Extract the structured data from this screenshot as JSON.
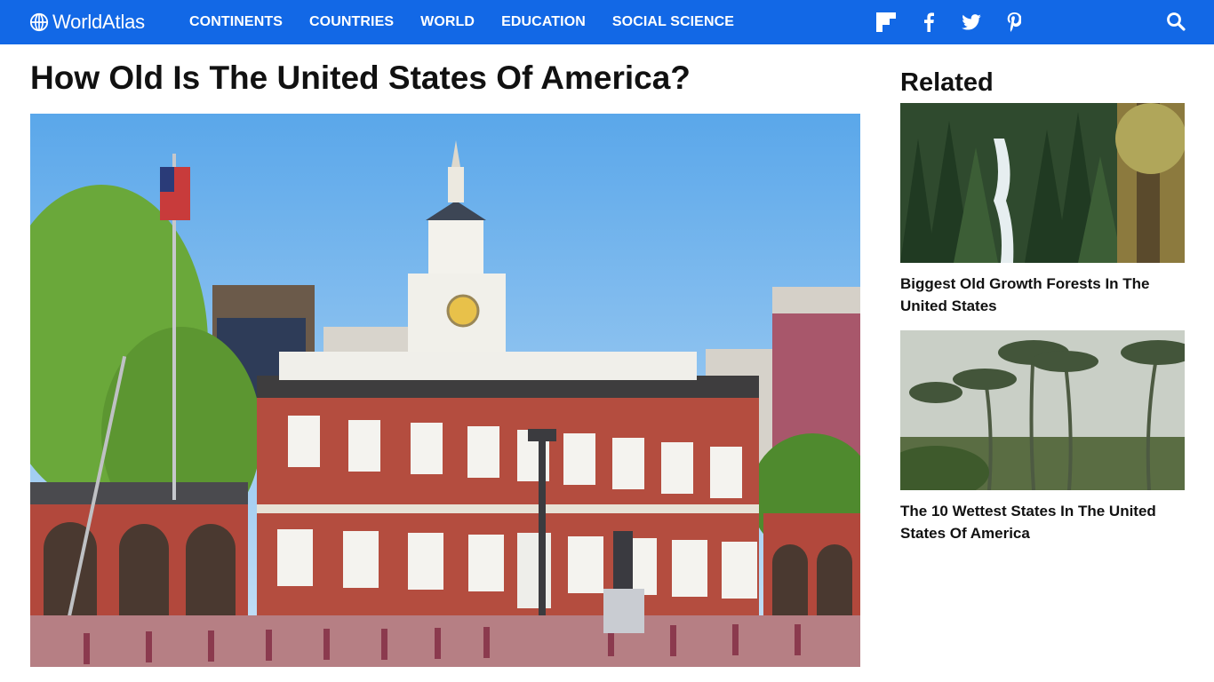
{
  "header": {
    "logo_text": "WorldAtlas",
    "nav": [
      "CONTINENTS",
      "COUNTRIES",
      "WORLD",
      "EDUCATION",
      "SOCIAL SCIENCE"
    ],
    "social_icons": [
      "flipboard-icon",
      "facebook-icon",
      "twitter-icon",
      "pinterest-icon"
    ],
    "search_icon": "search-icon",
    "bar_color": "#1268e6"
  },
  "article": {
    "title": "How Old Is The United States Of America?",
    "hero_image": "Independence Hall, Philadelphia"
  },
  "sidebar": {
    "heading": "Related",
    "items": [
      {
        "title": "Biggest Old Growth Forests In The United States",
        "thumb": "forest with waterfall"
      },
      {
        "title": "The 10 Wettest States In The United States Of America",
        "thumb": "palm trees in rain"
      }
    ]
  }
}
